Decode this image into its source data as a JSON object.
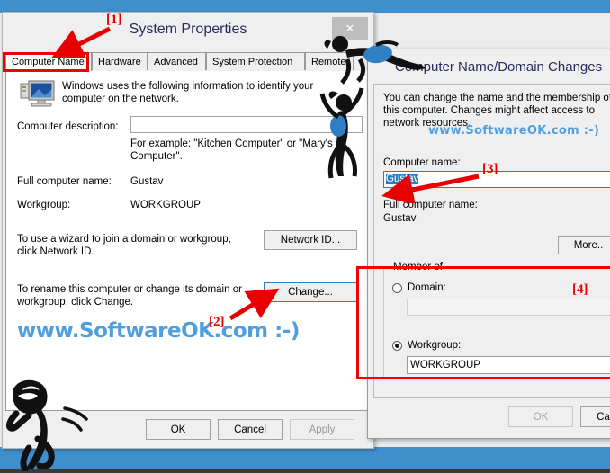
{
  "system_properties": {
    "title": "System Properties",
    "close_label": "✕",
    "tabs": [
      {
        "label": "Computer Name",
        "active": true
      },
      {
        "label": "Hardware",
        "active": false
      },
      {
        "label": "Advanced",
        "active": false
      },
      {
        "label": "System Protection",
        "active": false
      },
      {
        "label": "Remote",
        "active": false
      }
    ],
    "intro": "Windows uses the following information to identify your computer on the network.",
    "computer_description_label": "Computer description:",
    "computer_description_value": "",
    "computer_description_example": "For example: \"Kitchen Computer\" or \"Mary's Computer\".",
    "full_computer_name_label": "Full computer name:",
    "full_computer_name_value": "Gustav",
    "workgroup_label": "Workgroup:",
    "workgroup_value": "WORKGROUP",
    "wizard_text": "To use a wizard to join a domain or workgroup, click Network ID.",
    "network_id_button": "Network ID...",
    "rename_text": "To rename this computer or change its domain or workgroup, click Change.",
    "change_button": "Change...",
    "watermark": "www.SoftwareOK.com :-)",
    "ok_button": "OK",
    "cancel_button": "Cancel",
    "apply_button": "Apply"
  },
  "domain_changes": {
    "title": "Computer Name/Domain Changes",
    "intro": "You can change the name and the membership of this computer. Changes might affect access to network resources.",
    "watermark": "www.SoftwareOK.com :-)",
    "computer_name_label": "Computer name:",
    "computer_name_value": "Gustav",
    "full_computer_name_label": "Full computer name:",
    "full_computer_name_value": "Gustav",
    "more_button": "More..",
    "member_of_legend": "Member of",
    "domain_label": "Domain:",
    "domain_value": "",
    "domain_selected": false,
    "workgroup_label": "Workgroup:",
    "workgroup_value": "WORKGROUP",
    "workgroup_selected": true,
    "ok_button": "OK",
    "cancel_button": "Cancel"
  },
  "annotations": {
    "one": "[1]",
    "two": "[2]",
    "three": "[3]",
    "four": "[4]"
  },
  "colors": {
    "accent_blue": "#3e8fcc",
    "annotation_red": "#f20000",
    "watermark_blue": "#4f9fe0",
    "title_text": "#2a2a5e"
  }
}
